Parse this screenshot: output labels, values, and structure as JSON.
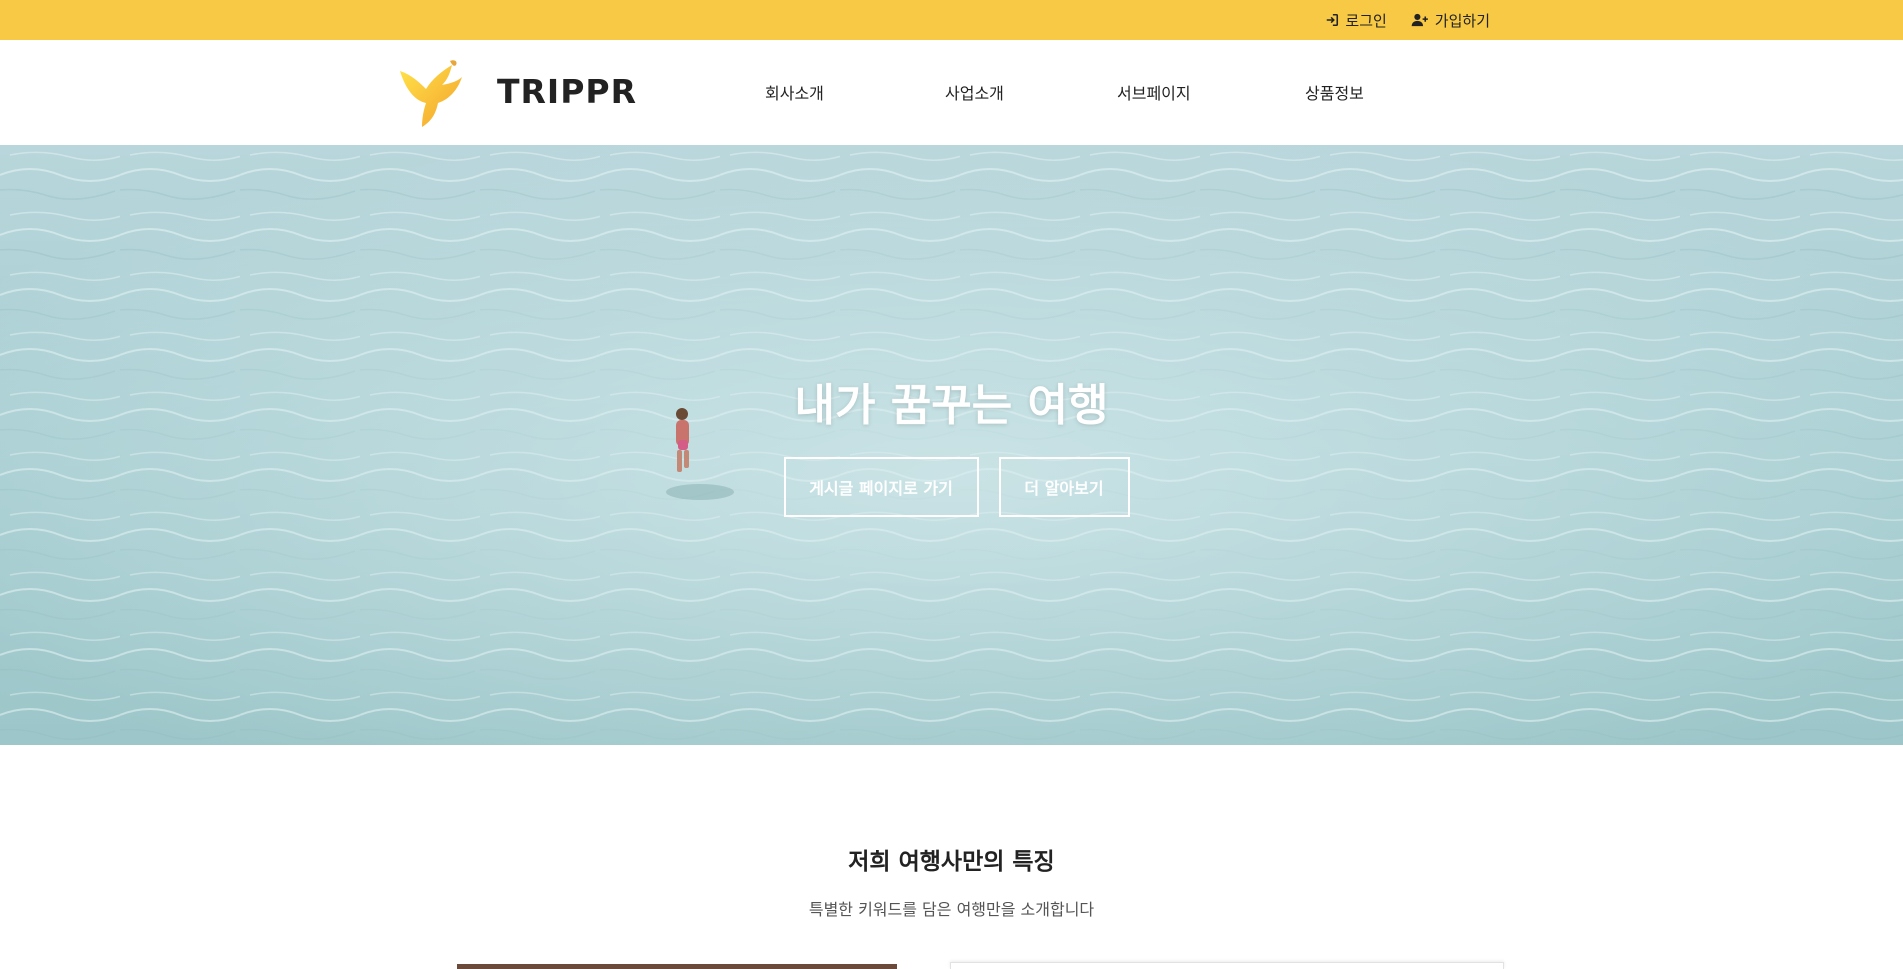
{
  "topbar": {
    "login_label": "로그인",
    "signup_label": "가입하기",
    "background_color": "#f8c945"
  },
  "header": {
    "brand": "TRIPPR",
    "logo_icon": "banana-logo-icon",
    "nav": [
      {
        "label": "회사소개"
      },
      {
        "label": "사업소개"
      },
      {
        "label": "서브페이지"
      },
      {
        "label": "상품정보"
      }
    ]
  },
  "hero": {
    "title": "내가 꿈꾸는 여행",
    "primary_button": "게시글 페이지로 가기",
    "secondary_button": "더 알아보기"
  },
  "features": {
    "title": "저희 여행사만의 특징",
    "subtitle": "특별한 키워드를 담은 여행만을 소개합니다"
  },
  "colors": {
    "accent": "#f8c945",
    "text": "#222222"
  }
}
